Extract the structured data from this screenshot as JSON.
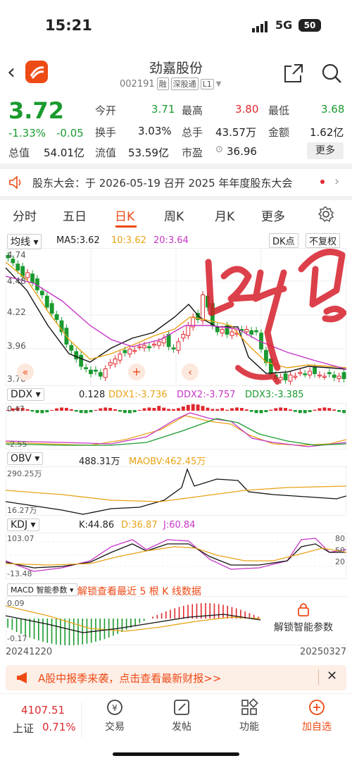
{
  "status": {
    "time": "15:21",
    "network": "5G",
    "battery": "50"
  },
  "header": {
    "title": "劲嘉股份",
    "code": "002191",
    "badges": [
      "融",
      "深股通",
      "L1"
    ]
  },
  "quote": {
    "price": "3.72",
    "change_pct": "-1.33%",
    "change": "-0.05",
    "fields": [
      {
        "label": "今开",
        "value": "3.71",
        "color": "#1a9a2f"
      },
      {
        "label": "最高",
        "value": "3.80",
        "color": "#e0282e"
      },
      {
        "label": "最低",
        "value": "3.68",
        "color": "#1a9a2f"
      },
      {
        "label": "换手",
        "value": "3.03%",
        "color": "#222"
      },
      {
        "label": "总手",
        "value": "43.57万",
        "color": "#222"
      },
      {
        "label": "金额",
        "value": "1.62亿",
        "color": "#222"
      },
      {
        "label": "总值",
        "value": "54.01亿",
        "color": "#222"
      },
      {
        "label": "流值",
        "value": "53.59亿",
        "color": "#222"
      },
      {
        "label": "市盈",
        "value": "36.96",
        "color": "#222"
      }
    ],
    "more_label": "更多"
  },
  "notice": {
    "text": "股东大会：于 2026-05-19 召开 2025 年年度股东大会"
  },
  "tabs": [
    "分时",
    "五日",
    "日K",
    "周K",
    "月K",
    "更多"
  ],
  "active_tab": "日K",
  "kline": {
    "ma_select": "均线",
    "ma5": "MA5:3.62",
    "ma10": "10:3.62",
    "ma20": "20:3.64",
    "dk_button": "DK点",
    "adjust_button": "不复权",
    "y_labels": [
      "4.74",
      "4.48",
      "4.22",
      "3.96",
      "3.70"
    ]
  },
  "indicators": {
    "ddx": {
      "name": "DDX",
      "v": "0.128",
      "v1": "DDX1:-3.736",
      "v2": "DDX2:-3.757",
      "v3": "DDX3:-3.385",
      "ymax": "0.47",
      "ymin": "-2.55"
    },
    "obv": {
      "name": "OBV",
      "v": "488.31万",
      "ma": "MAOBV:462.45万",
      "ymax": "290.25万",
      "ymin": "16.27万"
    },
    "kdj": {
      "name": "KDJ",
      "k": "K:44.86",
      "d": "D:36.87",
      "j": "J:60.84",
      "ymax": "103.07",
      "ymin": "-13.48",
      "levels": [
        "80",
        "50",
        "20"
      ]
    },
    "macd": {
      "name": "MACD 智能参数",
      "hint": "解锁查看最近 5 根 K 线数据",
      "ymax": "0.09",
      "ymin": "-0.17",
      "start_date": "20241220",
      "end_date": "20250327",
      "unlock": "解锁智能参数"
    }
  },
  "promo": {
    "text": "A股中报季来袭，点击查看最新财报>>"
  },
  "bottom": {
    "index_value": "4107.51",
    "index_name": "上证",
    "index_change": "0.71%",
    "items": [
      "交易",
      "发帖",
      "功能",
      "加自选"
    ]
  },
  "colors": {
    "up": "#e0282e",
    "down": "#1a9a2f",
    "accent": "#ee4a16"
  }
}
